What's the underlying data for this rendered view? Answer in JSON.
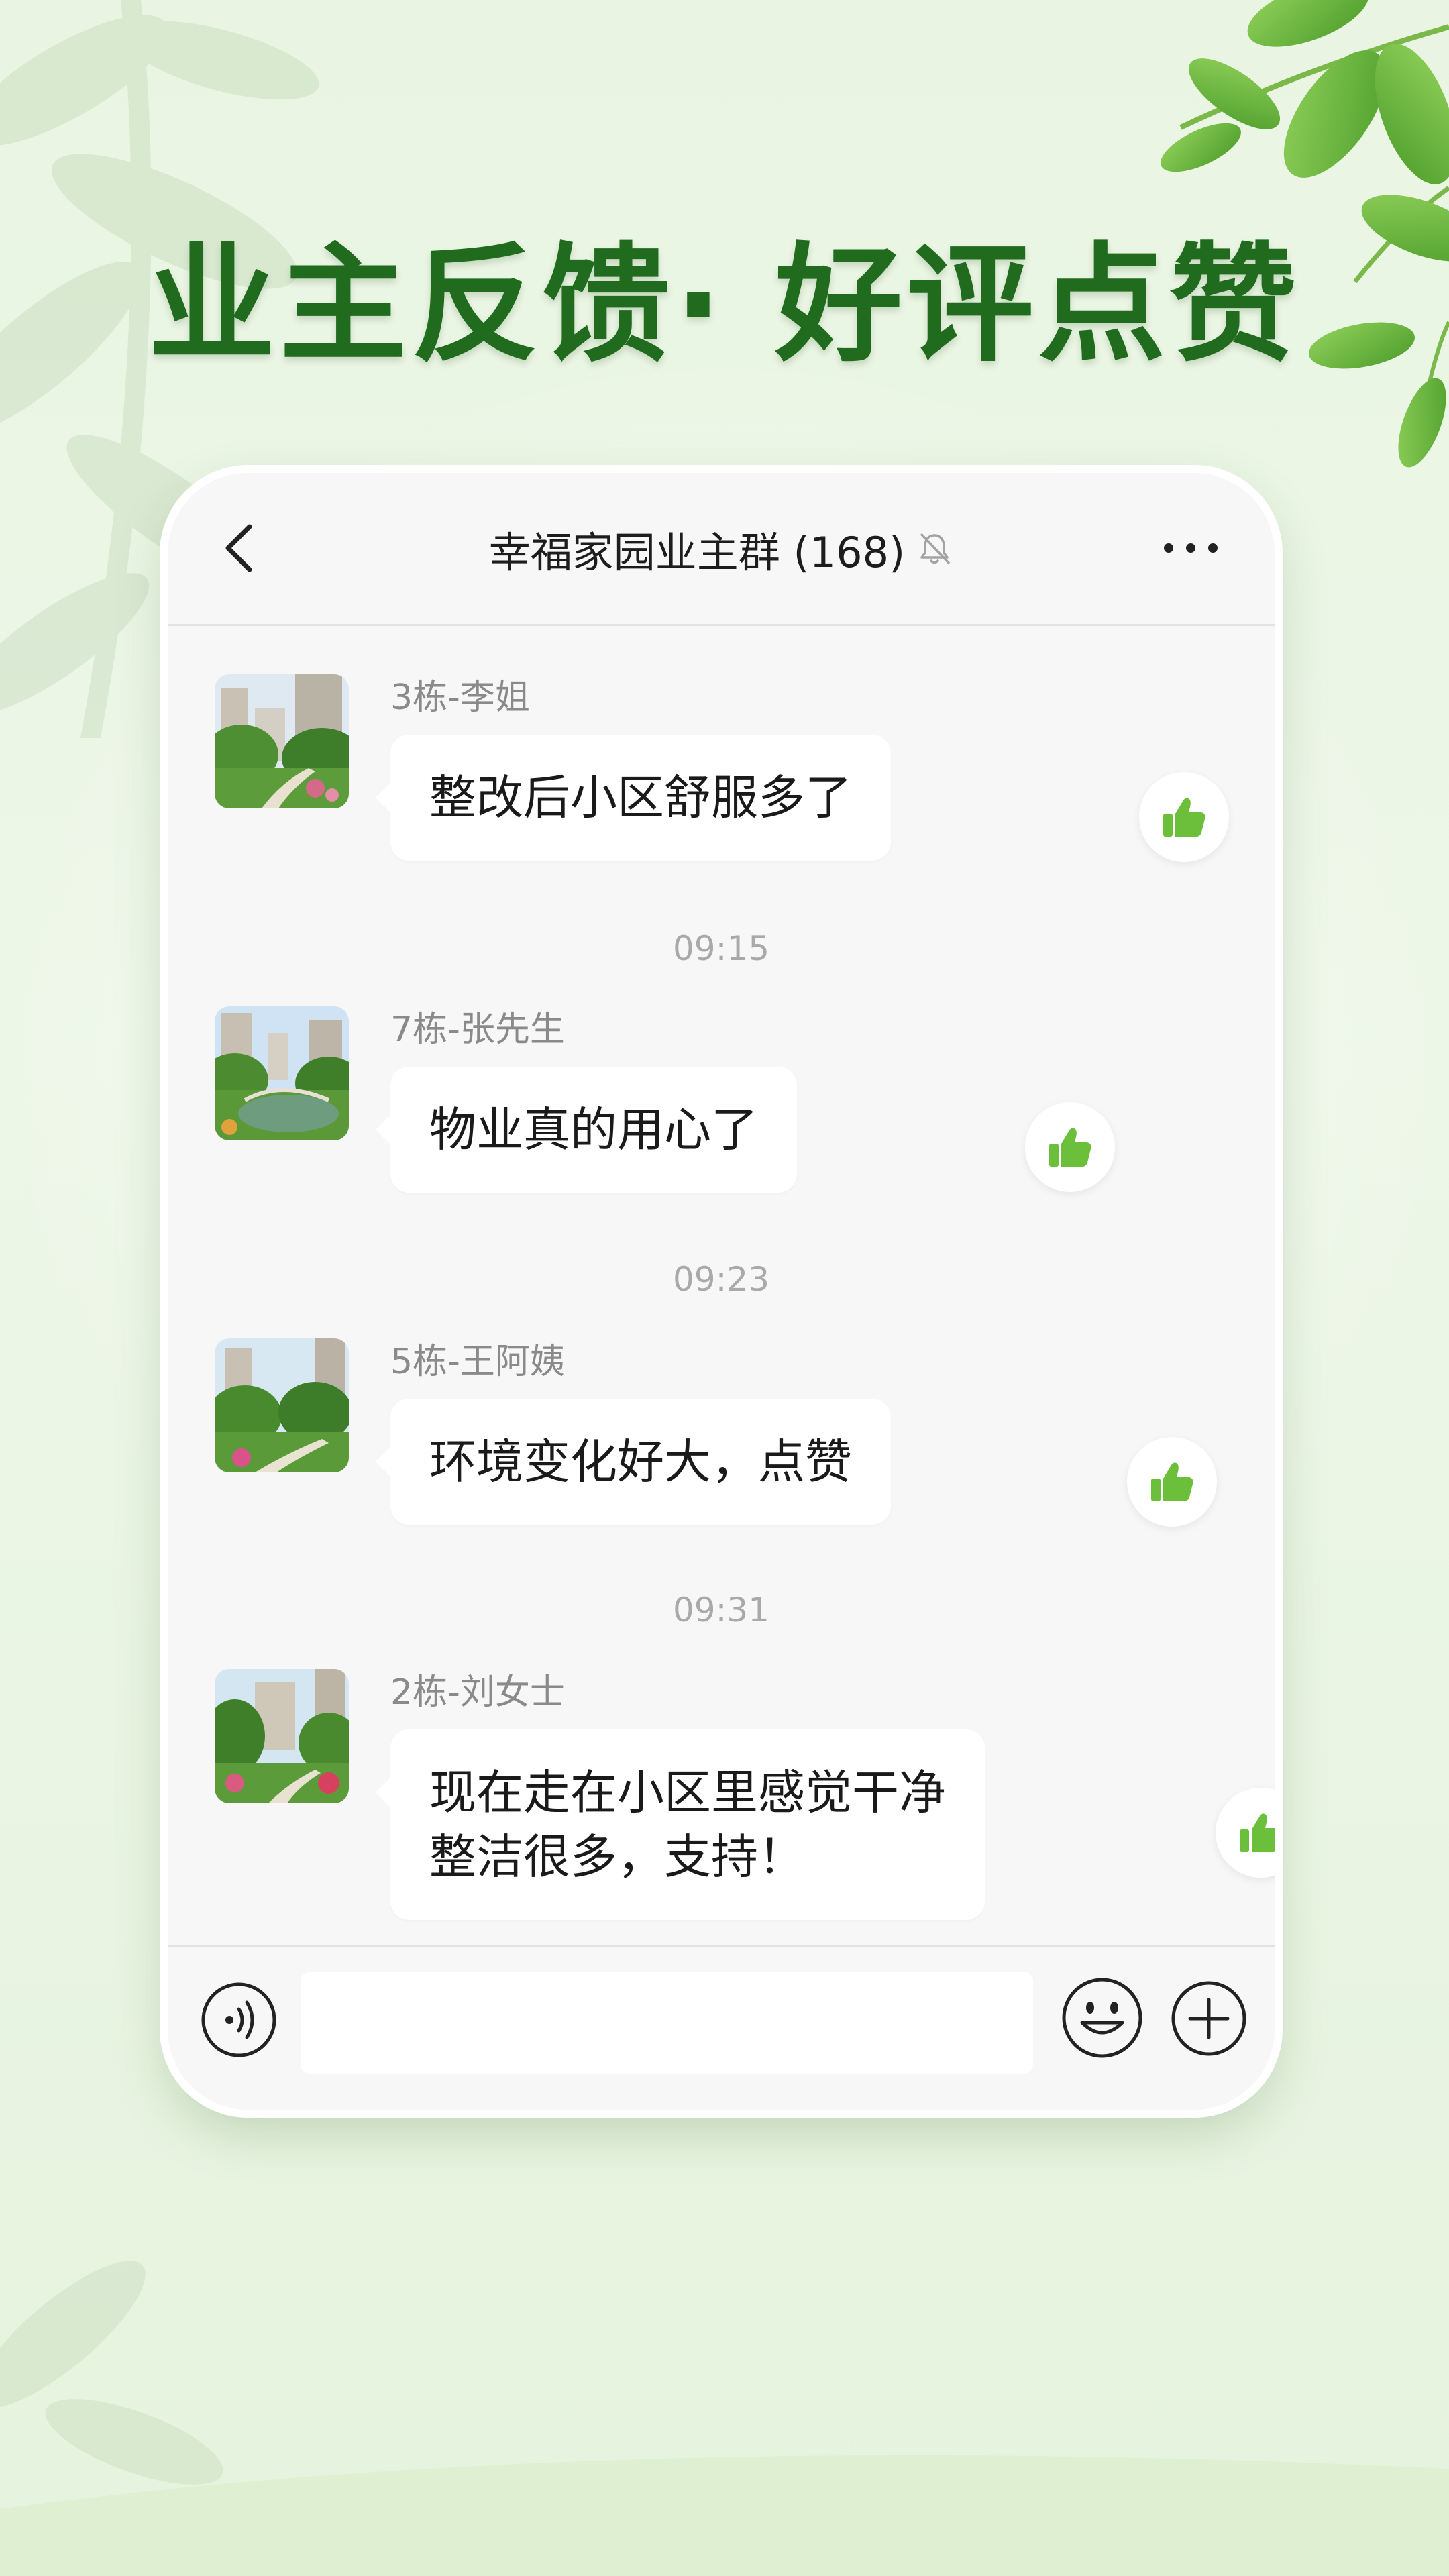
{
  "poster": {
    "title": "业主反馈· 好评点赞"
  },
  "chat": {
    "title": "幸福家园业主群 (168)",
    "icons": {
      "back": "chevron-left-icon",
      "mute": "bell-off-icon",
      "more": "more-dots-icon",
      "like": "thumbs-up-icon"
    },
    "messages": [
      {
        "sender": "3栋-李姐",
        "text": "整改后小区舒服多了"
      },
      {
        "timestamp": "09:15"
      },
      {
        "sender": "7栋-张先生",
        "text": "物业真的用心了"
      },
      {
        "timestamp": "09:23"
      },
      {
        "sender": "5栋-王阿姨",
        "text": "环境变化好大，点赞"
      },
      {
        "timestamp": "09:31"
      },
      {
        "sender": "2栋-刘女士",
        "text_lines": [
          "现在走在小区里感觉干净",
          "整洁很多，支持！"
        ]
      }
    ]
  },
  "composer": {
    "input_value": "",
    "icons": [
      "voice-icon",
      "emoji-icon",
      "plus-icon"
    ]
  },
  "colors": {
    "title_green": "#216b1e",
    "like_green": "#6cbf3b",
    "bubble_bg": "#ffffff",
    "chat_bg": "#f7f7f7",
    "page_bg": "#e9f5e2"
  }
}
